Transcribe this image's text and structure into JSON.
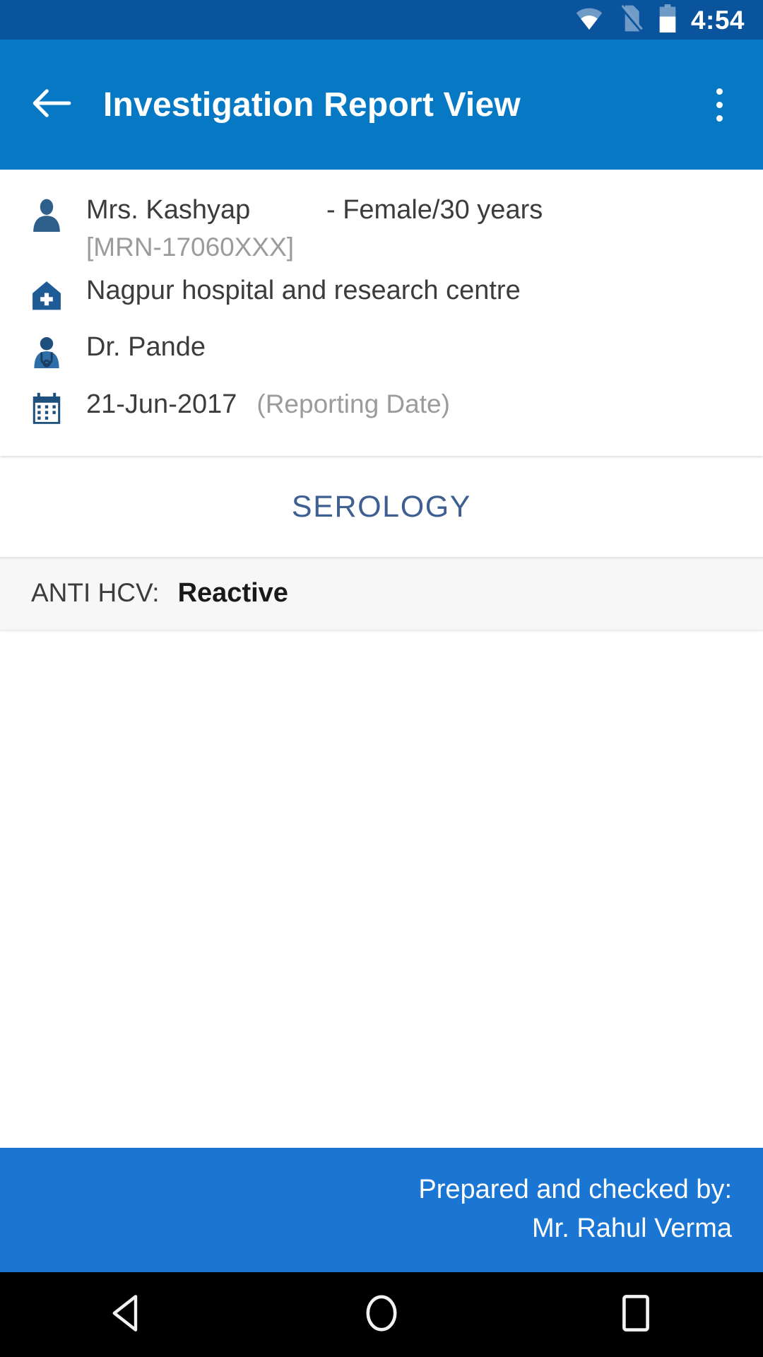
{
  "status_bar": {
    "time": "4:54",
    "icons": [
      "wifi-icon",
      "no-sim-icon",
      "battery-icon"
    ],
    "background_color": "#0a549e"
  },
  "app_bar": {
    "back_icon": "back-arrow-icon",
    "title": "Investigation Report View",
    "overflow_icon": "overflow-menu-icon",
    "background_color": "#0779c4"
  },
  "patient": {
    "person_icon": "person-icon",
    "name": "Mrs. Kashyap",
    "demographics": "- Female/30 years",
    "mrn": "[MRN-17060XXX]",
    "hospital_icon": "hospital-icon",
    "hospital": "Nagpur hospital and research centre",
    "doctor_icon": "doctor-icon",
    "doctor": "Dr. Pande",
    "calendar_icon": "calendar-icon",
    "date": "21-Jun-2017",
    "date_note": "(Reporting Date)"
  },
  "report": {
    "section_title": "SEROLOGY",
    "section_title_color": "#3d5f91",
    "results": [
      {
        "label": "ANTI HCV:",
        "value": "Reactive"
      }
    ]
  },
  "footer": {
    "line1": "Prepared and checked by:",
    "line2": "Mr. Rahul Verma",
    "background_color": "#1a76d2"
  },
  "nav_bar": {
    "back_icon": "nav-back-icon",
    "home_icon": "nav-home-icon",
    "recents_icon": "nav-recents-icon"
  }
}
